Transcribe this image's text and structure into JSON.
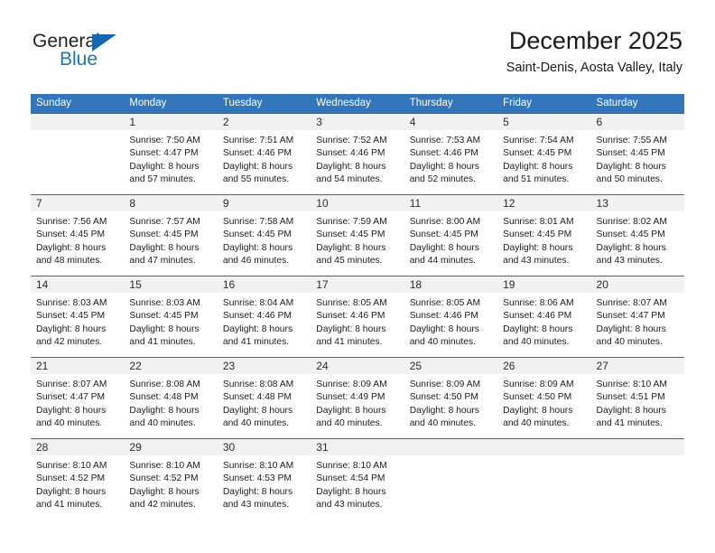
{
  "branding": {
    "name_primary": "General",
    "name_secondary": "Blue",
    "triangle_color": "#1567b2",
    "secondary_color": "#1b75bb"
  },
  "header": {
    "title": "December 2025",
    "subtitle": "Saint-Denis, Aosta Valley, Italy"
  },
  "theme": {
    "header_row_bg": "#3275b8",
    "cell_border": "#2e6da4",
    "daynum_band_bg": "#f1f1f1"
  },
  "weekday_headers": [
    "Sunday",
    "Monday",
    "Tuesday",
    "Wednesday",
    "Thursday",
    "Friday",
    "Saturday"
  ],
  "weeks": [
    [
      {
        "day": "",
        "sunrise": "",
        "sunset": "",
        "daylight1": "",
        "daylight2": "",
        "empty": true
      },
      {
        "day": "1",
        "sunrise": "Sunrise: 7:50 AM",
        "sunset": "Sunset: 4:47 PM",
        "daylight1": "Daylight: 8 hours",
        "daylight2": "and 57 minutes."
      },
      {
        "day": "2",
        "sunrise": "Sunrise: 7:51 AM",
        "sunset": "Sunset: 4:46 PM",
        "daylight1": "Daylight: 8 hours",
        "daylight2": "and 55 minutes."
      },
      {
        "day": "3",
        "sunrise": "Sunrise: 7:52 AM",
        "sunset": "Sunset: 4:46 PM",
        "daylight1": "Daylight: 8 hours",
        "daylight2": "and 54 minutes."
      },
      {
        "day": "4",
        "sunrise": "Sunrise: 7:53 AM",
        "sunset": "Sunset: 4:46 PM",
        "daylight1": "Daylight: 8 hours",
        "daylight2": "and 52 minutes."
      },
      {
        "day": "5",
        "sunrise": "Sunrise: 7:54 AM",
        "sunset": "Sunset: 4:45 PM",
        "daylight1": "Daylight: 8 hours",
        "daylight2": "and 51 minutes."
      },
      {
        "day": "6",
        "sunrise": "Sunrise: 7:55 AM",
        "sunset": "Sunset: 4:45 PM",
        "daylight1": "Daylight: 8 hours",
        "daylight2": "and 50 minutes."
      }
    ],
    [
      {
        "day": "7",
        "sunrise": "Sunrise: 7:56 AM",
        "sunset": "Sunset: 4:45 PM",
        "daylight1": "Daylight: 8 hours",
        "daylight2": "and 48 minutes."
      },
      {
        "day": "8",
        "sunrise": "Sunrise: 7:57 AM",
        "sunset": "Sunset: 4:45 PM",
        "daylight1": "Daylight: 8 hours",
        "daylight2": "and 47 minutes."
      },
      {
        "day": "9",
        "sunrise": "Sunrise: 7:58 AM",
        "sunset": "Sunset: 4:45 PM",
        "daylight1": "Daylight: 8 hours",
        "daylight2": "and 46 minutes."
      },
      {
        "day": "10",
        "sunrise": "Sunrise: 7:59 AM",
        "sunset": "Sunset: 4:45 PM",
        "daylight1": "Daylight: 8 hours",
        "daylight2": "and 45 minutes."
      },
      {
        "day": "11",
        "sunrise": "Sunrise: 8:00 AM",
        "sunset": "Sunset: 4:45 PM",
        "daylight1": "Daylight: 8 hours",
        "daylight2": "and 44 minutes."
      },
      {
        "day": "12",
        "sunrise": "Sunrise: 8:01 AM",
        "sunset": "Sunset: 4:45 PM",
        "daylight1": "Daylight: 8 hours",
        "daylight2": "and 43 minutes."
      },
      {
        "day": "13",
        "sunrise": "Sunrise: 8:02 AM",
        "sunset": "Sunset: 4:45 PM",
        "daylight1": "Daylight: 8 hours",
        "daylight2": "and 43 minutes."
      }
    ],
    [
      {
        "day": "14",
        "sunrise": "Sunrise: 8:03 AM",
        "sunset": "Sunset: 4:45 PM",
        "daylight1": "Daylight: 8 hours",
        "daylight2": "and 42 minutes."
      },
      {
        "day": "15",
        "sunrise": "Sunrise: 8:03 AM",
        "sunset": "Sunset: 4:45 PM",
        "daylight1": "Daylight: 8 hours",
        "daylight2": "and 41 minutes."
      },
      {
        "day": "16",
        "sunrise": "Sunrise: 8:04 AM",
        "sunset": "Sunset: 4:46 PM",
        "daylight1": "Daylight: 8 hours",
        "daylight2": "and 41 minutes."
      },
      {
        "day": "17",
        "sunrise": "Sunrise: 8:05 AM",
        "sunset": "Sunset: 4:46 PM",
        "daylight1": "Daylight: 8 hours",
        "daylight2": "and 41 minutes."
      },
      {
        "day": "18",
        "sunrise": "Sunrise: 8:05 AM",
        "sunset": "Sunset: 4:46 PM",
        "daylight1": "Daylight: 8 hours",
        "daylight2": "and 40 minutes."
      },
      {
        "day": "19",
        "sunrise": "Sunrise: 8:06 AM",
        "sunset": "Sunset: 4:46 PM",
        "daylight1": "Daylight: 8 hours",
        "daylight2": "and 40 minutes."
      },
      {
        "day": "20",
        "sunrise": "Sunrise: 8:07 AM",
        "sunset": "Sunset: 4:47 PM",
        "daylight1": "Daylight: 8 hours",
        "daylight2": "and 40 minutes."
      }
    ],
    [
      {
        "day": "21",
        "sunrise": "Sunrise: 8:07 AM",
        "sunset": "Sunset: 4:47 PM",
        "daylight1": "Daylight: 8 hours",
        "daylight2": "and 40 minutes."
      },
      {
        "day": "22",
        "sunrise": "Sunrise: 8:08 AM",
        "sunset": "Sunset: 4:48 PM",
        "daylight1": "Daylight: 8 hours",
        "daylight2": "and 40 minutes."
      },
      {
        "day": "23",
        "sunrise": "Sunrise: 8:08 AM",
        "sunset": "Sunset: 4:48 PM",
        "daylight1": "Daylight: 8 hours",
        "daylight2": "and 40 minutes."
      },
      {
        "day": "24",
        "sunrise": "Sunrise: 8:09 AM",
        "sunset": "Sunset: 4:49 PM",
        "daylight1": "Daylight: 8 hours",
        "daylight2": "and 40 minutes."
      },
      {
        "day": "25",
        "sunrise": "Sunrise: 8:09 AM",
        "sunset": "Sunset: 4:50 PM",
        "daylight1": "Daylight: 8 hours",
        "daylight2": "and 40 minutes."
      },
      {
        "day": "26",
        "sunrise": "Sunrise: 8:09 AM",
        "sunset": "Sunset: 4:50 PM",
        "daylight1": "Daylight: 8 hours",
        "daylight2": "and 40 minutes."
      },
      {
        "day": "27",
        "sunrise": "Sunrise: 8:10 AM",
        "sunset": "Sunset: 4:51 PM",
        "daylight1": "Daylight: 8 hours",
        "daylight2": "and 41 minutes."
      }
    ],
    [
      {
        "day": "28",
        "sunrise": "Sunrise: 8:10 AM",
        "sunset": "Sunset: 4:52 PM",
        "daylight1": "Daylight: 8 hours",
        "daylight2": "and 41 minutes."
      },
      {
        "day": "29",
        "sunrise": "Sunrise: 8:10 AM",
        "sunset": "Sunset: 4:52 PM",
        "daylight1": "Daylight: 8 hours",
        "daylight2": "and 42 minutes."
      },
      {
        "day": "30",
        "sunrise": "Sunrise: 8:10 AM",
        "sunset": "Sunset: 4:53 PM",
        "daylight1": "Daylight: 8 hours",
        "daylight2": "and 43 minutes."
      },
      {
        "day": "31",
        "sunrise": "Sunrise: 8:10 AM",
        "sunset": "Sunset: 4:54 PM",
        "daylight1": "Daylight: 8 hours",
        "daylight2": "and 43 minutes."
      },
      {
        "day": "",
        "sunrise": "",
        "sunset": "",
        "daylight1": "",
        "daylight2": "",
        "empty": true
      },
      {
        "day": "",
        "sunrise": "",
        "sunset": "",
        "daylight1": "",
        "daylight2": "",
        "empty": true
      },
      {
        "day": "",
        "sunrise": "",
        "sunset": "",
        "daylight1": "",
        "daylight2": "",
        "empty": true
      }
    ]
  ]
}
